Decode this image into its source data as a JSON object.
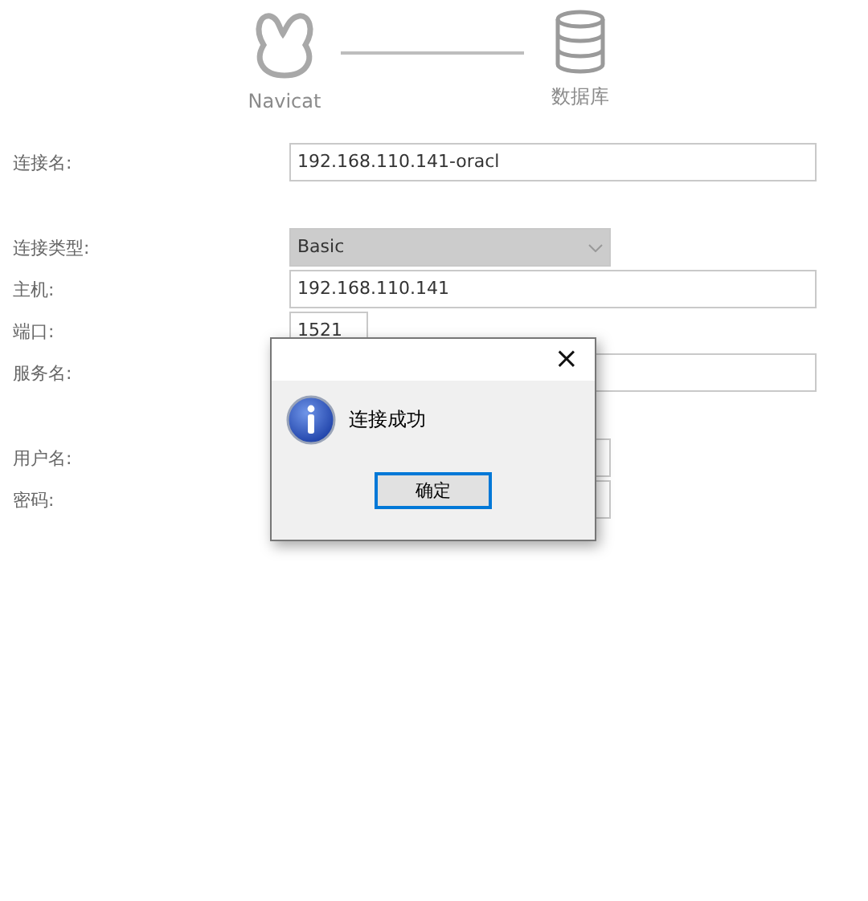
{
  "header": {
    "source_label": "Navicat",
    "target_label": "数据库"
  },
  "form": {
    "rows": [
      {
        "kind": "text",
        "label": "连接名:",
        "value": "192.168.110.141-oracl"
      },
      {
        "kind": "select",
        "label": "连接类型:",
        "value": "Basic"
      },
      {
        "kind": "text",
        "label": "主机:",
        "value": "192.168.110.141"
      },
      {
        "kind": "short",
        "label": "端口:",
        "value": "1521"
      },
      {
        "kind": "text",
        "label": "服务名:",
        "value": ""
      },
      {
        "kind": "medium",
        "label": "用户名:",
        "value": ""
      },
      {
        "kind": "medium",
        "label": "密码:",
        "value": ""
      }
    ]
  },
  "dialog": {
    "close": "×",
    "message": "连接成功",
    "button": "确定"
  }
}
